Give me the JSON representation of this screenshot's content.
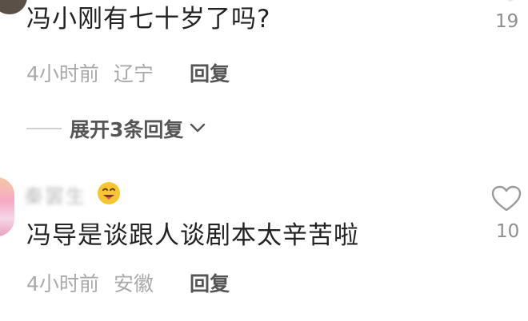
{
  "comment1": {
    "text": "冯小刚有七十岁了吗?",
    "likes": "19",
    "time": "4小时前",
    "location": "辽宁",
    "reply_label": "回复"
  },
  "expand": {
    "label": "展开3条回复"
  },
  "comment2": {
    "username": "秦罢生",
    "text": "冯导是谈跟人谈剧本太辛苦啦",
    "likes": "10",
    "time": "4小时前",
    "location": "安徽",
    "reply_label": "回复"
  }
}
